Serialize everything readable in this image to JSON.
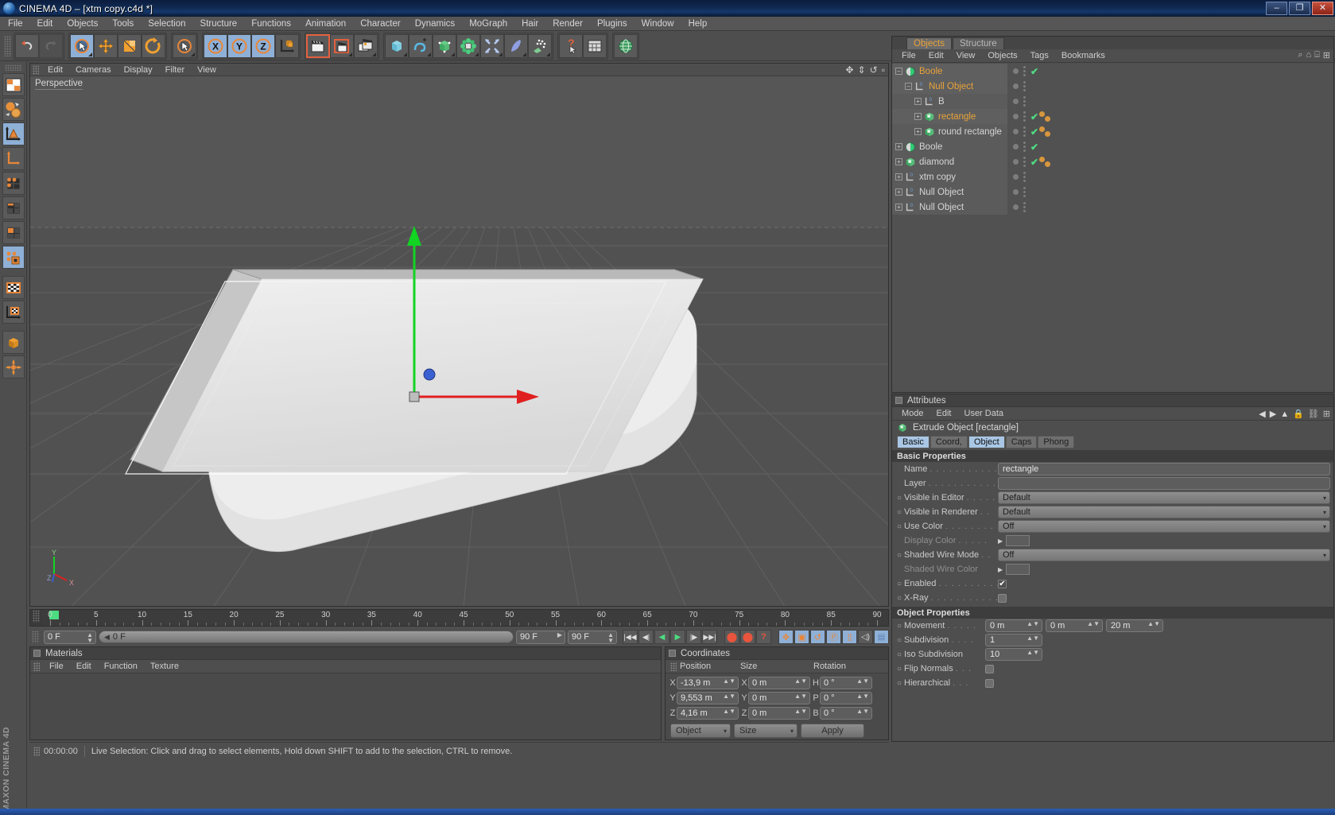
{
  "titlebar": {
    "title": "CINEMA 4D – [xtm copy.c4d *]",
    "app_icon": "c4d-logo-icon",
    "minimize": "–",
    "maximize": "❐",
    "close": "✕"
  },
  "menubar": {
    "items": [
      "File",
      "Edit",
      "Objects",
      "Tools",
      "Selection",
      "Structure",
      "Functions",
      "Animation",
      "Character",
      "Dynamics",
      "MoGraph",
      "Hair",
      "Render",
      "Plugins",
      "Window",
      "Help"
    ]
  },
  "toolbar": {
    "groups": [
      {
        "buttons": [
          {
            "name": "undo-icon",
            "glyph": "↶",
            "state": "normal"
          },
          {
            "name": "redo-icon",
            "glyph": "↷",
            "state": "disabled"
          }
        ]
      },
      {
        "buttons": [
          {
            "name": "live-selection-icon",
            "glyph": "◉",
            "state": "selected"
          },
          {
            "name": "move-tool-icon",
            "glyph": "✥",
            "state": "normal"
          },
          {
            "name": "scale-tool-icon",
            "glyph": "▣",
            "state": "normal"
          },
          {
            "name": "rotate-tool-icon",
            "glyph": "↺",
            "state": "normal"
          }
        ]
      },
      {
        "buttons": [
          {
            "name": "selection-mode-icon",
            "glyph": "◉",
            "state": "normal"
          }
        ]
      },
      {
        "buttons": [
          {
            "name": "lock-x-axis-icon",
            "glyph": "X",
            "state": "selected"
          },
          {
            "name": "lock-y-axis-icon",
            "glyph": "Y",
            "state": "selected"
          },
          {
            "name": "lock-z-axis-icon",
            "glyph": "Z",
            "state": "selected"
          },
          {
            "name": "world-object-coordinates-icon",
            "glyph": "⬓",
            "state": "normal"
          }
        ]
      },
      {
        "buttons": [
          {
            "name": "render-view-icon",
            "glyph": "🎬",
            "state": "highlighted"
          },
          {
            "name": "render-region-icon",
            "glyph": "🎬",
            "state": "normal"
          },
          {
            "name": "render-settings-icon",
            "glyph": "🎬",
            "state": "normal"
          }
        ]
      },
      {
        "buttons": [
          {
            "name": "add-cube-primitive-icon",
            "glyph": "▢",
            "state": "normal"
          },
          {
            "name": "add-spline-icon",
            "glyph": "〜",
            "state": "normal"
          },
          {
            "name": "add-nurbs-icon",
            "glyph": "◧",
            "state": "normal"
          },
          {
            "name": "add-modeling-object-icon",
            "glyph": "✾",
            "state": "normal"
          },
          {
            "name": "add-deformer-icon",
            "glyph": "✣",
            "state": "normal"
          },
          {
            "name": "add-scene-object-icon",
            "glyph": "◗",
            "state": "normal"
          },
          {
            "name": "add-particle-system-icon",
            "glyph": "∴",
            "state": "normal"
          }
        ]
      },
      {
        "buttons": [
          {
            "name": "help-cursor-icon",
            "glyph": "?",
            "state": "normal"
          },
          {
            "name": "content-browser-icon",
            "glyph": "▦",
            "state": "normal"
          }
        ]
      },
      {
        "buttons": [
          {
            "name": "web-icon",
            "glyph": "⊕",
            "state": "normal"
          }
        ]
      }
    ]
  },
  "left_toolbar": {
    "buttons": [
      {
        "name": "make-editable-icon",
        "glyph": "▦",
        "state": "normal"
      },
      {
        "name": "model-object-mode-icon",
        "glyph": "◍",
        "state": "normal"
      },
      {
        "name": "model-mode-icon",
        "glyph": "△",
        "state": "selected"
      },
      {
        "name": "object-axis-mode-icon",
        "glyph": "⌐",
        "state": "normal"
      },
      {
        "name": "points-mode-icon",
        "glyph": "⦁",
        "state": "normal"
      },
      {
        "name": "edges-mode-icon",
        "glyph": "▤",
        "state": "normal"
      },
      {
        "name": "polygons-mode-icon",
        "glyph": "▧",
        "state": "normal"
      },
      {
        "name": "enable-axis-modification-icon",
        "glyph": "◈",
        "state": "selected"
      },
      {
        "name": "texture-mode-icon",
        "glyph": "▩",
        "state": "normal"
      },
      {
        "name": "texture-axis-mode-icon",
        "glyph": "▨",
        "state": "normal"
      },
      {
        "name": "viewport-solo-icon",
        "glyph": "◆",
        "state": "normal"
      },
      {
        "name": "animation-layout-icon",
        "glyph": "✺",
        "state": "normal"
      }
    ],
    "brand": "MAXON CINEMA 4D"
  },
  "viewport": {
    "menu": [
      "Edit",
      "Cameras",
      "Display",
      "Filter",
      "View"
    ],
    "label": "Perspective",
    "view_buttons": [
      "move-view-icon",
      "scale-view-icon",
      "rotate-view-icon",
      "maximize-view-icon"
    ],
    "axis_gizmo": {
      "y": "Y",
      "z": "Z",
      "x": "X"
    },
    "gizmo": {
      "y_axis_color": "#12d423",
      "x_axis_color": "#e02020",
      "z_axis_color": "#3a5fd0"
    }
  },
  "timeline": {
    "labels": [
      0,
      5,
      10,
      15,
      20,
      25,
      30,
      35,
      40,
      45,
      50,
      55,
      60,
      65,
      70,
      75,
      80,
      85,
      90
    ],
    "current_frame_field": "0 F",
    "start_marker": "0"
  },
  "transport": {
    "current_frame": "0 F",
    "scrub_value": "0 F",
    "range_end": "90 F",
    "range_end2": "90 F",
    "buttons": [
      {
        "name": "go-to-start-button",
        "glyph": "|◀◀"
      },
      {
        "name": "step-back-button",
        "glyph": "◀|"
      },
      {
        "name": "play-backwards-button",
        "glyph": "◀"
      },
      {
        "name": "play-forward-button",
        "glyph": "▶"
      },
      {
        "name": "step-forward-button",
        "glyph": "|▶"
      },
      {
        "name": "go-to-end-button",
        "glyph": "▶▶|"
      }
    ],
    "record_buttons": [
      {
        "name": "record-active-objects-button",
        "glyph": "⬤"
      },
      {
        "name": "autokeying-button",
        "glyph": "⬤"
      },
      {
        "name": "keyframe-selection-button",
        "glyph": "?"
      }
    ],
    "key_toggle_buttons": [
      {
        "name": "position-key-toggle",
        "glyph": "✥",
        "state": "selected"
      },
      {
        "name": "scale-key-toggle",
        "glyph": "▣",
        "state": "selected"
      },
      {
        "name": "rotation-key-toggle",
        "glyph": "↺",
        "state": "selected"
      },
      {
        "name": "parameter-key-toggle",
        "glyph": "Ⓟ",
        "state": "selected"
      },
      {
        "name": "point-level-animation-toggle",
        "glyph": "⣿",
        "state": "selected"
      },
      {
        "name": "auto-keyframing-toggle",
        "glyph": "🔊",
        "state": "normal"
      },
      {
        "name": "keyframe-preset-button",
        "glyph": "▤",
        "state": "selected"
      }
    ]
  },
  "materials": {
    "title": "Materials",
    "menu": [
      "File",
      "Edit",
      "Function",
      "Texture"
    ]
  },
  "coordinates": {
    "title": "Coordinates",
    "columns": [
      "Position",
      "Size",
      "Rotation"
    ],
    "rows": [
      {
        "position_axis": "X",
        "position_value": "-13,9 m",
        "size_axis": "X",
        "size_value": "0 m",
        "rot_axis": "H",
        "rot_value": "0 °"
      },
      {
        "position_axis": "Y",
        "position_value": "9,553 m",
        "size_axis": "Y",
        "size_value": "0 m",
        "rot_axis": "P",
        "rot_value": "0 °"
      },
      {
        "position_axis": "Z",
        "position_value": "4,16 m",
        "size_axis": "Z",
        "size_value": "0 m",
        "rot_axis": "B",
        "rot_value": "0 °"
      }
    ],
    "coord_system": "Object",
    "size_mode": "Size",
    "apply_label": "Apply"
  },
  "statusbar": {
    "time": "00:00:00",
    "message": "Live Selection: Click and drag to select elements, Hold down SHIFT to add to the selection, CTRL to remove."
  },
  "object_manager": {
    "tabs": [
      {
        "label": "Objects",
        "active": true
      },
      {
        "label": "Structure",
        "active": false
      }
    ],
    "menu": [
      "File",
      "Edit",
      "View",
      "Objects",
      "Tags",
      "Bookmarks"
    ],
    "header_icons": [
      "search-icon",
      "home-icon",
      "layers-icon",
      "expand-icon"
    ],
    "rows": [
      {
        "name": "Boole",
        "icon": "boole-icon",
        "indent": 0,
        "expander": "minus",
        "selected": true,
        "visible_dot": true,
        "check": true,
        "tags": 0
      },
      {
        "name": "Null Object",
        "icon": "null-icon",
        "indent": 1,
        "expander": "minus",
        "selected": true,
        "visible_dot": true,
        "check": false,
        "tags": 0
      },
      {
        "name": "B",
        "icon": "null-icon",
        "indent": 2,
        "expander": "plus",
        "selected": false,
        "visible_dot": true,
        "check": false,
        "tags": 0
      },
      {
        "name": "rectangle",
        "icon": "extrude-icon",
        "indent": 2,
        "expander": "plus",
        "selected": true,
        "visible_dot": true,
        "check": true,
        "tags": 2
      },
      {
        "name": "round rectangle",
        "icon": "extrude-icon",
        "indent": 2,
        "expander": "plus",
        "selected": false,
        "visible_dot": true,
        "check": true,
        "tags": 2
      },
      {
        "name": "Boole",
        "icon": "boole-icon",
        "indent": 0,
        "expander": "plus",
        "selected": false,
        "visible_dot": true,
        "check": true,
        "tags": 0
      },
      {
        "name": "diamond",
        "icon": "extrude-icon",
        "indent": 0,
        "expander": "plus",
        "selected": false,
        "visible_dot": true,
        "check": true,
        "tags": 2
      },
      {
        "name": "xtm copy",
        "icon": "null-icon",
        "indent": 0,
        "expander": "plus",
        "selected": false,
        "visible_dot": true,
        "check": false,
        "tags": 0
      },
      {
        "name": "Null Object",
        "icon": "null-icon",
        "indent": 0,
        "expander": "plus",
        "selected": false,
        "visible_dot": true,
        "check": false,
        "tags": 0
      },
      {
        "name": "Null Object",
        "icon": "null-icon",
        "indent": 0,
        "expander": "plus",
        "selected": false,
        "visible_dot": true,
        "check": false,
        "tags": 0
      }
    ]
  },
  "attributes": {
    "title": "Attributes",
    "menu": [
      "Mode",
      "Edit",
      "User Data"
    ],
    "object_header": "Extrude Object [rectangle]",
    "object_icon": "extrude-icon",
    "tabs": [
      {
        "label": "Basic",
        "active": true
      },
      {
        "label": "Coord,",
        "active": false
      },
      {
        "label": "Object",
        "active": true
      },
      {
        "label": "Caps",
        "active": false
      },
      {
        "label": "Phong",
        "active": false
      }
    ],
    "basic_section": "Basic Properties",
    "basic_rows": [
      {
        "label": "Name",
        "dots": ". . . . . . . . . . . . .",
        "type": "text",
        "value": "rectangle",
        "bullet": false,
        "dim": false
      },
      {
        "label": "Layer",
        "dots": ". . . . . . . . . . . . .",
        "type": "text",
        "value": "",
        "bullet": false,
        "dim": false
      },
      {
        "label": "Visible in Editor",
        "dots": ". . . . .",
        "type": "combo",
        "value": "Default",
        "bullet": true,
        "dim": false
      },
      {
        "label": "Visible in Renderer",
        "dots": ". .",
        "type": "combo",
        "value": "Default",
        "bullet": true,
        "dim": false
      },
      {
        "label": "Use Color",
        "dots": ". . . . . . . . . .",
        "type": "combo",
        "value": "Off",
        "bullet": true,
        "dim": false
      },
      {
        "label": "Display Color",
        "dots": ". . . . .",
        "type": "color",
        "value": "",
        "bullet": false,
        "dim": true
      },
      {
        "label": "Shaded Wire Mode",
        "dots": ". .",
        "type": "combo",
        "value": "Off",
        "bullet": true,
        "dim": false
      },
      {
        "label": "Shaded Wire Color",
        "dots": "",
        "type": "color",
        "value": "",
        "bullet": false,
        "dim": true
      },
      {
        "label": "Enabled",
        "dots": ". . . . . . . . . . . .",
        "type": "check",
        "value": "✔",
        "bullet": true,
        "dim": false
      },
      {
        "label": "X-Ray",
        "dots": ". . . . . . . . . . . . .",
        "type": "checkempty",
        "value": "",
        "bullet": true,
        "dim": false
      }
    ],
    "object_section": "Object Properties",
    "object_rows": [
      {
        "label": "Movement",
        "dots": ". . . . .",
        "type": "num3",
        "values": [
          "0 m",
          "0 m",
          "20 m"
        ]
      },
      {
        "label": "Subdivision",
        "dots": ". . . .",
        "type": "num1",
        "values": [
          "1"
        ]
      },
      {
        "label": "Iso Subdivision",
        "dots": "",
        "type": "num1",
        "values": [
          "10"
        ]
      },
      {
        "label": "Flip Normals",
        "dots": ". . .",
        "type": "checkempty",
        "values": [
          ""
        ]
      },
      {
        "label": "Hierarchical",
        "dots": ". . .",
        "type": "checkempty",
        "values": [
          ""
        ]
      }
    ]
  }
}
